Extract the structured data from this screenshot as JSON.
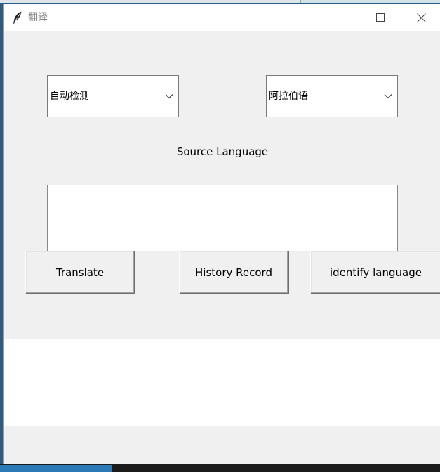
{
  "window": {
    "title": "翻译",
    "icon": "feather-icon",
    "controls": [
      "minimize-icon",
      "maximize-icon",
      "close-icon"
    ]
  },
  "source_language_select": {
    "selected": "自动检测"
  },
  "target_language_select": {
    "selected": "阿拉伯语"
  },
  "source_label": "Source Language",
  "source_text": {
    "value": ""
  },
  "buttons": {
    "translate": "Translate",
    "history": "History Record",
    "identify": "identify language"
  },
  "result_text": {
    "value": ""
  },
  "colors": {
    "window_bg": "#f0f0f0",
    "titlebar_bg": "#ffffff",
    "title_text": "#808080"
  }
}
